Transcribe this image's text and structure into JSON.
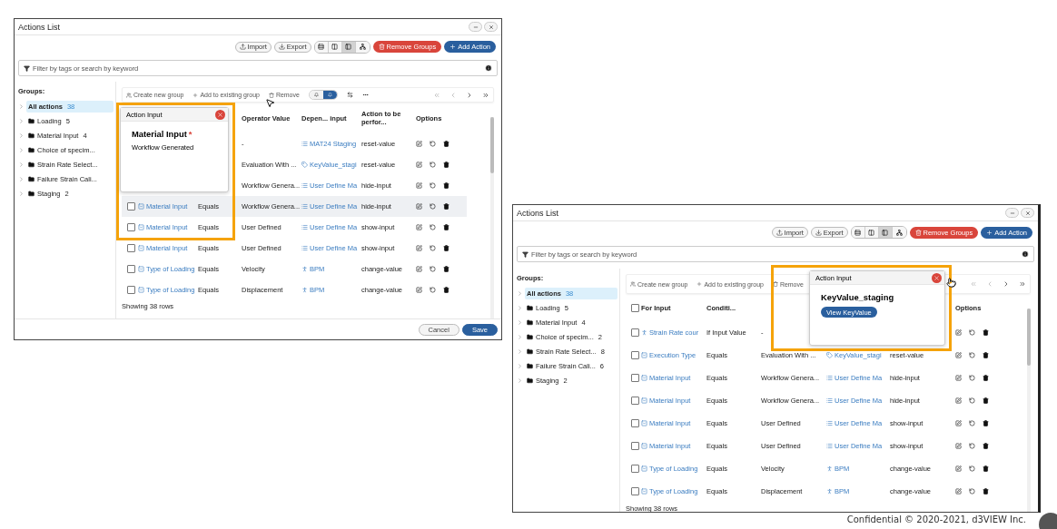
{
  "windows": [
    {
      "title": "Actions List",
      "import": "Import",
      "export": "Export",
      "views": [
        {
          "kind": "rows",
          "selected": false
        },
        {
          "kind": "columns",
          "selected": false
        },
        {
          "kind": "split",
          "selected": true
        },
        {
          "kind": "tree",
          "selected": false
        }
      ],
      "remove_groups": "Remove Groups",
      "add_action": "Add Action",
      "filter": {
        "placeholder": "Filter by tags or search by keyword"
      },
      "groups": {
        "label": "Groups:",
        "items": [
          {
            "name": "All actions",
            "count": "38",
            "selected": true
          },
          {
            "name": "Loading",
            "count": "5",
            "selected": false
          },
          {
            "name": "Material Input",
            "count": "4",
            "selected": false
          },
          {
            "name": "Choice of specim...",
            "selected": false
          },
          {
            "name": "Strain Rate Select...",
            "selected": false
          },
          {
            "name": "Failure Strain Cali...",
            "selected": false
          },
          {
            "name": "Staging",
            "count": "2",
            "selected": false
          }
        ]
      },
      "group_actions": [
        "Create new group",
        "Add to existing group",
        "Remove"
      ],
      "toggle": [
        {
          "selected": false
        },
        {
          "selected": true
        }
      ],
      "columns": [
        null,
        null,
        null,
        "Operator Value",
        "Depen... input",
        "Action to be perfor...",
        "Options"
      ],
      "rows": [
        {
          "highlighted": false,
          "cells": [
            null,
            null,
            null,
            {
              "kind": "text",
              "text": "-"
            },
            {
              "kind": "list-link",
              "text": "MAT24 Staging"
            },
            {
              "kind": "text",
              "text": "reset-value"
            }
          ]
        },
        {
          "highlighted": false,
          "cells": [
            null,
            null,
            null,
            {
              "kind": "text",
              "text": "Evaluation With ..."
            },
            {
              "kind": "tag-link",
              "text": "KeyValue_stagi"
            },
            {
              "kind": "text",
              "text": "reset-value"
            }
          ]
        },
        {
          "highlighted": false,
          "cells": [
            null,
            null,
            null,
            {
              "kind": "text",
              "text": "Workflow Genera..."
            },
            {
              "kind": "list-link",
              "text": "User Define Ma"
            },
            {
              "kind": "text",
              "text": "hide-input"
            }
          ]
        },
        {
          "highlighted": true,
          "cells": [
            {
              "kind": "checkbox",
              "checked": false
            },
            {
              "kind": "form-link",
              "text": "Material Input"
            },
            {
              "kind": "text",
              "text": "Equals"
            },
            {
              "kind": "text",
              "text": "Workflow Genera..."
            },
            {
              "kind": "list-link",
              "text": "User Define Ma"
            },
            {
              "kind": "text",
              "text": "hide-input"
            }
          ]
        },
        {
          "highlighted": false,
          "cells": [
            {
              "kind": "checkbox",
              "checked": false
            },
            {
              "kind": "form-link",
              "text": "Material Input"
            },
            {
              "kind": "text",
              "text": "Equals"
            },
            {
              "kind": "text",
              "text": "User Defined"
            },
            {
              "kind": "list-link",
              "text": "User Define Ma"
            },
            {
              "kind": "text",
              "text": "show-input"
            }
          ]
        },
        {
          "highlighted": false,
          "cells": [
            {
              "kind": "checkbox",
              "checked": false
            },
            {
              "kind": "form-link",
              "text": "Material Input"
            },
            {
              "kind": "text",
              "text": "Equals"
            },
            {
              "kind": "text",
              "text": "User Defined"
            },
            {
              "kind": "list-link",
              "text": "User Define Ma"
            },
            {
              "kind": "text",
              "text": "show-input"
            }
          ]
        },
        {
          "highlighted": false,
          "cells": [
            {
              "kind": "checkbox",
              "checked": false
            },
            {
              "kind": "form-link",
              "text": "Type of Loading"
            },
            {
              "kind": "text",
              "text": "Equals"
            },
            {
              "kind": "text",
              "text": "Velocity"
            },
            {
              "kind": "person-link",
              "text": "BPM"
            },
            {
              "kind": "text",
              "text": "change-value"
            }
          ]
        },
        {
          "highlighted": false,
          "cells": [
            {
              "kind": "checkbox",
              "checked": false
            },
            {
              "kind": "form-link",
              "text": "Type of Loading"
            },
            {
              "kind": "text",
              "text": "Equals"
            },
            {
              "kind": "text",
              "text": "Displacement"
            },
            {
              "kind": "person-link",
              "text": "BPM"
            },
            {
              "kind": "text",
              "text": "change-value"
            }
          ]
        }
      ],
      "table_footer": "Showing 38 rows",
      "buttons": [
        "Cancel",
        "Save"
      ],
      "popup": {
        "title": "Action Input",
        "heading": "Material Input",
        "required_mark": "*",
        "text": "Workflow Generated"
      }
    },
    {
      "title": "Actions List",
      "import": "Import",
      "export": "Export",
      "views": [
        {
          "kind": "rows",
          "selected": false
        },
        {
          "kind": "columns",
          "selected": false
        },
        {
          "kind": "split",
          "selected": true
        },
        {
          "kind": "tree",
          "selected": false
        }
      ],
      "remove_groups": "Remove Groups",
      "add_action": "Add Action",
      "filter": {
        "placeholder": "Filter by tags or search by keyword"
      },
      "groups": {
        "label": "Groups:",
        "items": [
          {
            "name": "All actions",
            "count": "38",
            "selected": true
          },
          {
            "name": "Loading",
            "count": "5",
            "selected": false
          },
          {
            "name": "Material Input",
            "count": "4",
            "selected": false
          },
          {
            "name": "Choice of specim...",
            "count": "2",
            "selected": false
          },
          {
            "name": "Strain Rate Select...",
            "count": "8",
            "selected": false
          },
          {
            "name": "Failure Strain Cali...",
            "count": "6",
            "selected": false
          },
          {
            "name": "Staging",
            "count": "2",
            "selected": false
          }
        ]
      },
      "group_actions": [
        "Create new group",
        "Add to existing group",
        "Remove"
      ],
      "columns": [
        "",
        "For Input",
        "Conditi...",
        null,
        null,
        null,
        "Options"
      ],
      "header_checkbox": {
        "checked": false
      },
      "rows": [
        {
          "highlighted": false,
          "cells": [
            {
              "kind": "checkbox",
              "checked": false
            },
            {
              "kind": "person-link",
              "text": "Strain Rate cour"
            },
            {
              "kind": "text",
              "text": "If Input Value"
            },
            {
              "kind": "text",
              "text": "-"
            },
            null,
            null
          ]
        },
        {
          "highlighted": false,
          "cells": [
            {
              "kind": "checkbox",
              "checked": false
            },
            {
              "kind": "form-link",
              "text": "Execution Type"
            },
            {
              "kind": "text",
              "text": "Equals"
            },
            {
              "kind": "text",
              "text": "Evaluation With ..."
            },
            {
              "kind": "tag-link",
              "text": "KeyValue_stagi"
            },
            {
              "kind": "text",
              "text": "reset-value"
            }
          ]
        },
        {
          "highlighted": false,
          "cells": [
            {
              "kind": "checkbox",
              "checked": false
            },
            {
              "kind": "form-link",
              "text": "Material Input"
            },
            {
              "kind": "text",
              "text": "Equals"
            },
            {
              "kind": "text",
              "text": "Workflow Genera..."
            },
            {
              "kind": "list-link",
              "text": "User Define Ma"
            },
            {
              "kind": "text",
              "text": "hide-input"
            }
          ]
        },
        {
          "highlighted": false,
          "cells": [
            {
              "kind": "checkbox",
              "checked": false
            },
            {
              "kind": "form-link",
              "text": "Material Input"
            },
            {
              "kind": "text",
              "text": "Equals"
            },
            {
              "kind": "text",
              "text": "Workflow Genera..."
            },
            {
              "kind": "list-link",
              "text": "User Define Ma"
            },
            {
              "kind": "text",
              "text": "hide-input"
            }
          ]
        },
        {
          "highlighted": false,
          "cells": [
            {
              "kind": "checkbox",
              "checked": false
            },
            {
              "kind": "form-link",
              "text": "Material Input"
            },
            {
              "kind": "text",
              "text": "Equals"
            },
            {
              "kind": "text",
              "text": "User Defined"
            },
            {
              "kind": "list-link",
              "text": "User Define Ma"
            },
            {
              "kind": "text",
              "text": "show-input"
            }
          ]
        },
        {
          "highlighted": false,
          "cells": [
            {
              "kind": "checkbox",
              "checked": false
            },
            {
              "kind": "form-link",
              "text": "Material Input"
            },
            {
              "kind": "text",
              "text": "Equals"
            },
            {
              "kind": "text",
              "text": "User Defined"
            },
            {
              "kind": "list-link",
              "text": "User Define Ma"
            },
            {
              "kind": "text",
              "text": "show-input"
            }
          ]
        },
        {
          "highlighted": false,
          "cells": [
            {
              "kind": "checkbox",
              "checked": false
            },
            {
              "kind": "form-link",
              "text": "Type of Loading"
            },
            {
              "kind": "text",
              "text": "Equals"
            },
            {
              "kind": "text",
              "text": "Velocity"
            },
            {
              "kind": "person-link",
              "text": "BPM"
            },
            {
              "kind": "text",
              "text": "change-value"
            }
          ]
        },
        {
          "highlighted": false,
          "cells": [
            {
              "kind": "checkbox",
              "checked": false
            },
            {
              "kind": "form-link",
              "text": "Type of Loading"
            },
            {
              "kind": "text",
              "text": "Equals"
            },
            {
              "kind": "text",
              "text": "Displacement"
            },
            {
              "kind": "person-link",
              "text": "BPM"
            },
            {
              "kind": "text",
              "text": "change-value"
            }
          ]
        }
      ],
      "table_footer": "Showing 38 rows",
      "popup": {
        "title": "Action Input",
        "heading": "KeyValue_staging",
        "button": "View KeyValue"
      }
    }
  ],
  "footer": "Confidential © 2020-2021, d3VIEW Inc."
}
